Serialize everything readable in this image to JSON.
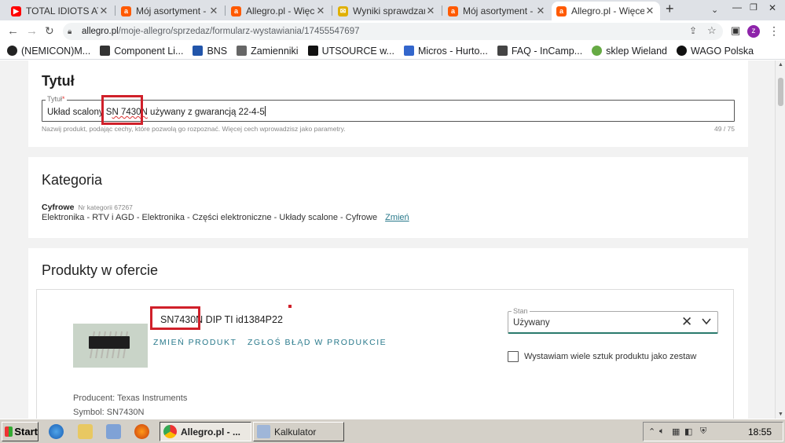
{
  "browser": {
    "tabs": [
      {
        "label": "TOTAL IDIOTS AT",
        "icon": "youtube-icon",
        "color": "#ff0000"
      },
      {
        "label": "Mój asortyment -",
        "icon": "allegro-icon",
        "color": "#ff5a00"
      },
      {
        "label": "Allegro.pl - Więce",
        "icon": "allegro-icon",
        "color": "#ff5a00"
      },
      {
        "label": "Wyniki sprawdzan",
        "icon": "mail-icon",
        "color": "#e0b000"
      },
      {
        "label": "Mój asortyment -",
        "icon": "allegro-icon",
        "color": "#ff5a00"
      },
      {
        "label": "Allegro.pl - Więce",
        "icon": "allegro-icon",
        "color": "#ff5a00",
        "active": true
      }
    ],
    "url_host": "allegro.pl",
    "url_path": "/moje-allegro/sprzedaz/formularz-wystawiania/17455547697",
    "profile_initial": "z",
    "bookmarks": [
      {
        "label": "(NEMICON)M...",
        "color": "#222"
      },
      {
        "label": "Component Li...",
        "color": "#333"
      },
      {
        "label": "BNS",
        "color": "#2255aa"
      },
      {
        "label": "Zamienniki",
        "color": "#666"
      },
      {
        "label": "UTSOURCE w...",
        "color": "#111"
      },
      {
        "label": "Micros - Hurto...",
        "color": "#3366cc"
      },
      {
        "label": "FAQ - InCamp...",
        "color": "#444"
      },
      {
        "label": "sklep Wieland",
        "color": "#66aa44"
      },
      {
        "label": "WAGO Polska",
        "color": "#111"
      }
    ]
  },
  "title_section": {
    "heading": "Tytuł",
    "field_label": "Tytuł",
    "required_mark": "*",
    "value_prefix": "Układ scalony S",
    "value_hl": "N 7430N",
    "value_suffix": " używany z gwarancją 22-4-5",
    "hint": "Nazwij produkt, podając cechy, które pozwolą go rozpoznać. Więcej cech wprowadzisz jako parametry.",
    "counter": "49  /  75"
  },
  "category_section": {
    "heading": "Kategoria",
    "name": "Cyfrowe",
    "number": "Nr kategorii 67267",
    "path": "Elektronika - RTV i AGD - Elektronika - Części elektroniczne - Układy scalone - Cyfrowe",
    "change_link": "Zmień"
  },
  "products_section": {
    "heading": "Produkty w ofercie",
    "product_title_hl": "SN7430N",
    "product_title_rest": " DIP TI id1384P22",
    "change_product": "ZMIEŃ PRODUKT",
    "report_error": "ZGŁOŚ BŁĄD W PRODUKCIE",
    "condition_label": "Stan",
    "condition_value": "Używany",
    "set_checkbox_label": "Wystawiam wiele sztuk produktu jako zestaw",
    "producer": "Producent: Texas Instruments",
    "symbol": "Symbol: SN7430N"
  },
  "taskbar": {
    "start": "Start",
    "tasks": [
      {
        "label": "Allegro.pl - ...",
        "active": true
      },
      {
        "label": "Kalkulator",
        "active": false
      }
    ],
    "clock": "18:55"
  }
}
